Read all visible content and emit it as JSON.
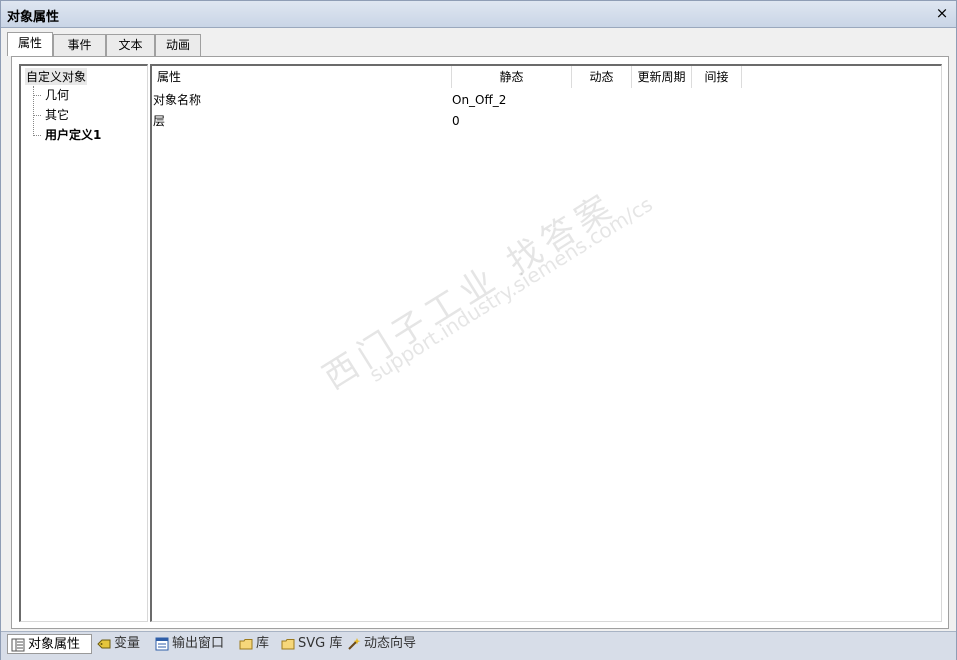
{
  "window": {
    "title": "对象属性",
    "close_label": "×"
  },
  "tabs": [
    {
      "label": "属性",
      "active": true
    },
    {
      "label": "事件",
      "active": false
    },
    {
      "label": "文本",
      "active": false
    },
    {
      "label": "动画",
      "active": false
    }
  ],
  "tree": {
    "root": "自定义对象",
    "children": [
      "几何",
      "其它",
      "用户定义1"
    ]
  },
  "grid": {
    "headers": [
      "属性",
      "静态",
      "动态",
      "更新周期",
      "间接"
    ],
    "rows": [
      {
        "name": "对象名称",
        "static": "On_Off_2"
      },
      {
        "name": "层",
        "static": "0"
      }
    ]
  },
  "watermark": {
    "line1": "西门子工业  找答案",
    "line2": "support.industry.siemens.com/cs"
  },
  "bottom_tabs": [
    {
      "label": "对象属性",
      "icon": "properties-icon",
      "active": true
    },
    {
      "label": "变量",
      "icon": "tag-icon",
      "active": false
    },
    {
      "label": "输出窗口",
      "icon": "output-window-icon",
      "active": false
    },
    {
      "label": "库",
      "icon": "folder-icon",
      "active": false
    },
    {
      "label": "SVG 库",
      "icon": "svg-folder-icon",
      "active": false
    },
    {
      "label": "动态向导",
      "icon": "wand-icon",
      "active": false
    }
  ]
}
